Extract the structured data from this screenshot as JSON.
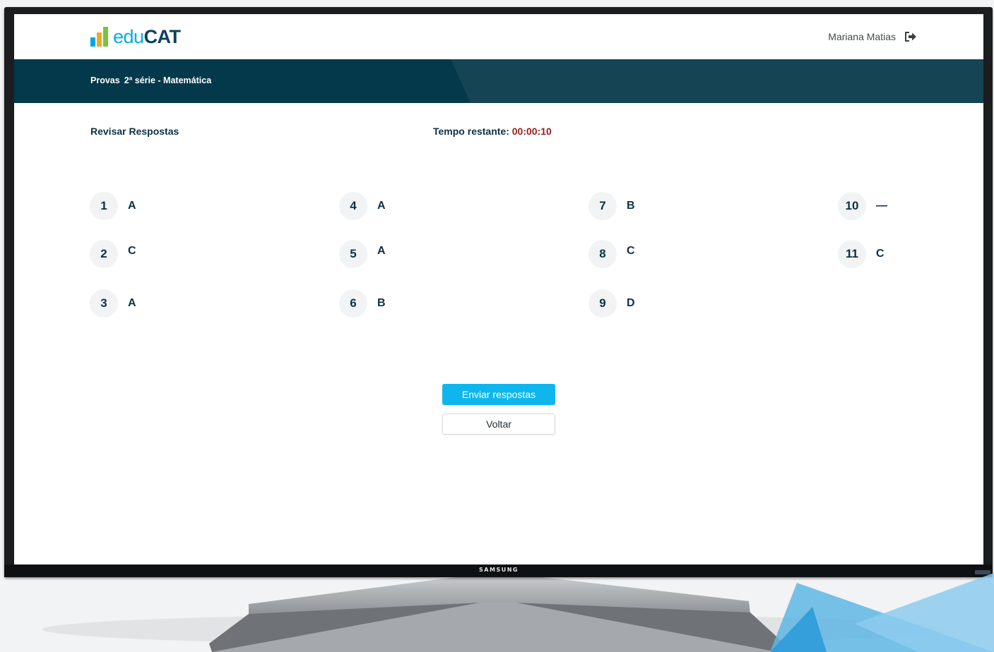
{
  "app": {
    "logo_prefix": "edu",
    "logo_suffix": "CAT",
    "user_name": "Mariana Matias"
  },
  "nav": {
    "breadcrumb": [
      "Provas",
      "2ª série - Matemática"
    ]
  },
  "review": {
    "title": "Revisar Respostas",
    "timer_label": "Tempo restante:",
    "timer_value": "00:00:10"
  },
  "answers": [
    {
      "number": "1",
      "answer": "A"
    },
    {
      "number": "2",
      "answer": "C"
    },
    {
      "number": "3",
      "answer": "A"
    },
    {
      "number": "4",
      "answer": "A"
    },
    {
      "number": "5",
      "answer": "A"
    },
    {
      "number": "6",
      "answer": "B"
    },
    {
      "number": "7",
      "answer": "B"
    },
    {
      "number": "8",
      "answer": "C"
    },
    {
      "number": "9",
      "answer": "D"
    },
    {
      "number": "10",
      "answer": "—"
    },
    {
      "number": "11",
      "answer": "C"
    }
  ],
  "actions": {
    "send_label": "Enviar respostas",
    "back_label": "Voltar"
  },
  "device": {
    "brand": "SAMSUNG"
  },
  "colors": {
    "accent": "#0fb6ee",
    "nav_bg": "#03394a",
    "text_dark": "#0d3144",
    "timer": "#9b1c1c"
  }
}
